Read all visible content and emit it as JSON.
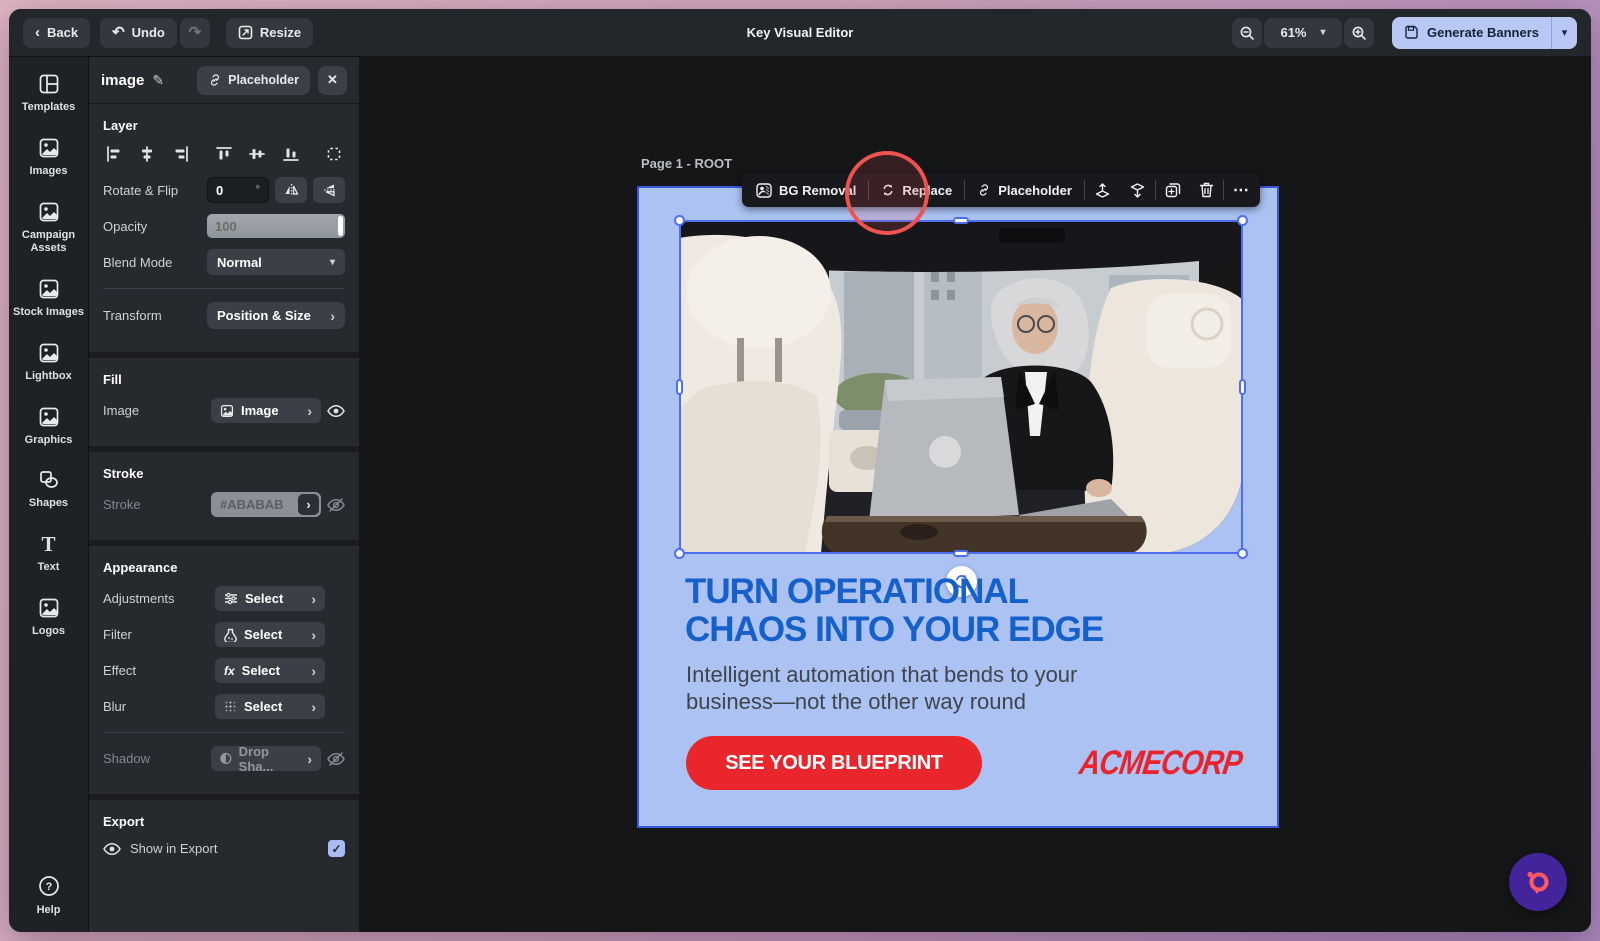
{
  "icons": {
    "back_chevron": "‹",
    "undo": "↶",
    "redo": "↷",
    "caret_down": "▾",
    "chevron_right": "›",
    "close": "✕",
    "pencil": "✎",
    "ellipsis": "⋯",
    "fx": "fx",
    "check": "✓",
    "text_tool": "T",
    "question": "?"
  },
  "topbar": {
    "back": "Back",
    "undo": "Undo",
    "resize": "Resize",
    "title": "Key Visual Editor",
    "zoom_level": "61%",
    "generate_banners": "Generate Banners"
  },
  "sidebar": {
    "items": [
      {
        "label": "Templates",
        "icon": "templates-icon"
      },
      {
        "label": "Images",
        "icon": "image-icon"
      },
      {
        "label": "Campaign Assets",
        "icon": "image-icon"
      },
      {
        "label": "Stock Images",
        "icon": "image-icon"
      },
      {
        "label": "Lightbox",
        "icon": "image-icon"
      },
      {
        "label": "Graphics",
        "icon": "image-icon"
      },
      {
        "label": "Shapes",
        "icon": "shapes-icon"
      },
      {
        "label": "Text",
        "icon": "text-icon"
      },
      {
        "label": "Logos",
        "icon": "image-icon"
      }
    ],
    "help": "Help"
  },
  "panel": {
    "title": "image",
    "placeholder_button": "Placeholder",
    "layer": {
      "heading": "Layer",
      "rotate_label": "Rotate & Flip",
      "rotate_value": "0",
      "rotate_unit": "°",
      "opacity_label": "Opacity",
      "opacity_value": "100",
      "blend_label": "Blend Mode",
      "blend_value": "Normal",
      "transform_label": "Transform",
      "transform_value": "Position & Size"
    },
    "fill": {
      "heading": "Fill",
      "image_label": "Image",
      "image_value": "Image"
    },
    "stroke": {
      "heading": "Stroke",
      "label": "Stroke",
      "value": "#ABABAB"
    },
    "appearance": {
      "heading": "Appearance",
      "rows": [
        {
          "label": "Adjustments",
          "value": "Select"
        },
        {
          "label": "Filter",
          "value": "Select"
        },
        {
          "label": "Effect",
          "value": "Select"
        },
        {
          "label": "Blur",
          "value": "Select"
        }
      ],
      "shadow_label": "Shadow",
      "shadow_value": "Drop Sha..."
    },
    "export": {
      "heading": "Export",
      "show_label": "Show in Export",
      "checked": true
    }
  },
  "canvas": {
    "page_label": "Page 1 - ROOT",
    "toolbar": {
      "bg_removal": "BG Removal",
      "replace": "Replace",
      "placeholder": "Placeholder"
    },
    "banner": {
      "headline_line1": "TURN OPERATIONAL",
      "headline_line2": "CHAOS INTO YOUR EDGE",
      "subtext_line1": "Intelligent automation that bends to your",
      "subtext_line2": "business—not the other way round",
      "cta": "SEE YOUR BLUEPRINT",
      "logo": "ACMECORP"
    }
  },
  "colors": {
    "banner_background": "#abc2f2",
    "headline_blue": "#1560cb",
    "cta_red": "#e8262b",
    "logo_red": "#e8232b",
    "selection_blue": "#3c56dd",
    "accent_periwinkle": "#b9c7f4",
    "annotation_red": "#ef5350",
    "assistant_purple": "#44249b",
    "assistant_coral": "#ff5a5f"
  }
}
